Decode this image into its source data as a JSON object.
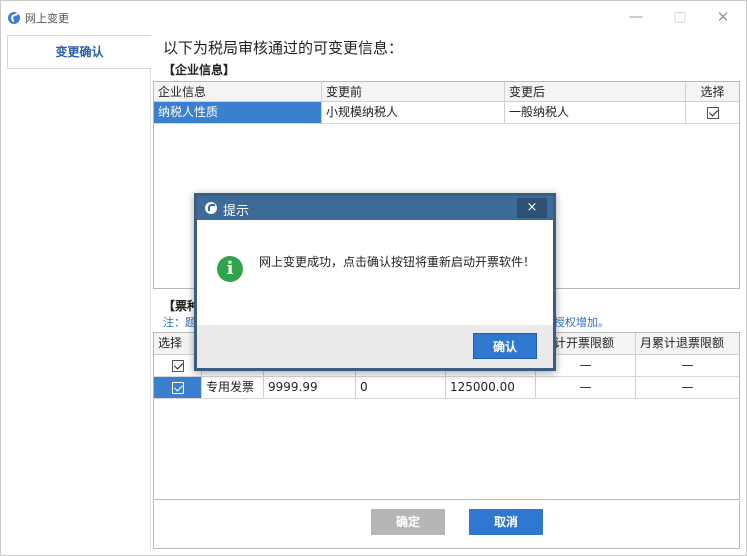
{
  "window": {
    "title": "网上变更",
    "min_glyph": "—",
    "max_glyph": "▢",
    "close_glyph": "✕"
  },
  "sidebar": {
    "items": [
      {
        "label": "变更确认"
      }
    ]
  },
  "main": {
    "heading": "以下为税局审核通过的可变更信息：",
    "enterprise_section_label": "【企业信息】",
    "enterprise_table": {
      "headers": [
        "企业信息",
        "变更前",
        "变更后",
        "选择"
      ],
      "rows": [
        {
          "field": "纳税人性质",
          "before": "小规模纳税人",
          "after": "一般纳税人",
          "checked": true
        }
      ]
    },
    "invoice_section_label": "【票种",
    "note_start": "注：题",
    "note_end": "授权增加。",
    "invoice_table": {
      "headers": [
        "选择",
        "累计开票限额",
        "月累计退票限额"
      ],
      "rows": [
        {
          "checked": true,
          "type": "",
          "limit": "",
          "count": "",
          "total": "",
          "col5": "—",
          "col6": "—",
          "selected": false
        },
        {
          "checked": true,
          "type": "专用发票",
          "limit": "9999.99",
          "count": "0",
          "total": "125000.00",
          "col5": "—",
          "col6": "—",
          "selected": true
        }
      ]
    },
    "buttons": {
      "ok": "确定",
      "cancel": "取消"
    }
  },
  "dialog": {
    "title": "提示",
    "close_glyph": "×",
    "icon": "info-icon",
    "icon_glyph": "i",
    "message": "网上变更成功，点击确认按钮将重新启动开票软件！",
    "confirm": "确认"
  },
  "colors": {
    "accent": "#2f78cf",
    "dialog_title": "#3e6a97",
    "info_icon": "#2fa44a",
    "disabled_button": "#b6b6b6"
  }
}
